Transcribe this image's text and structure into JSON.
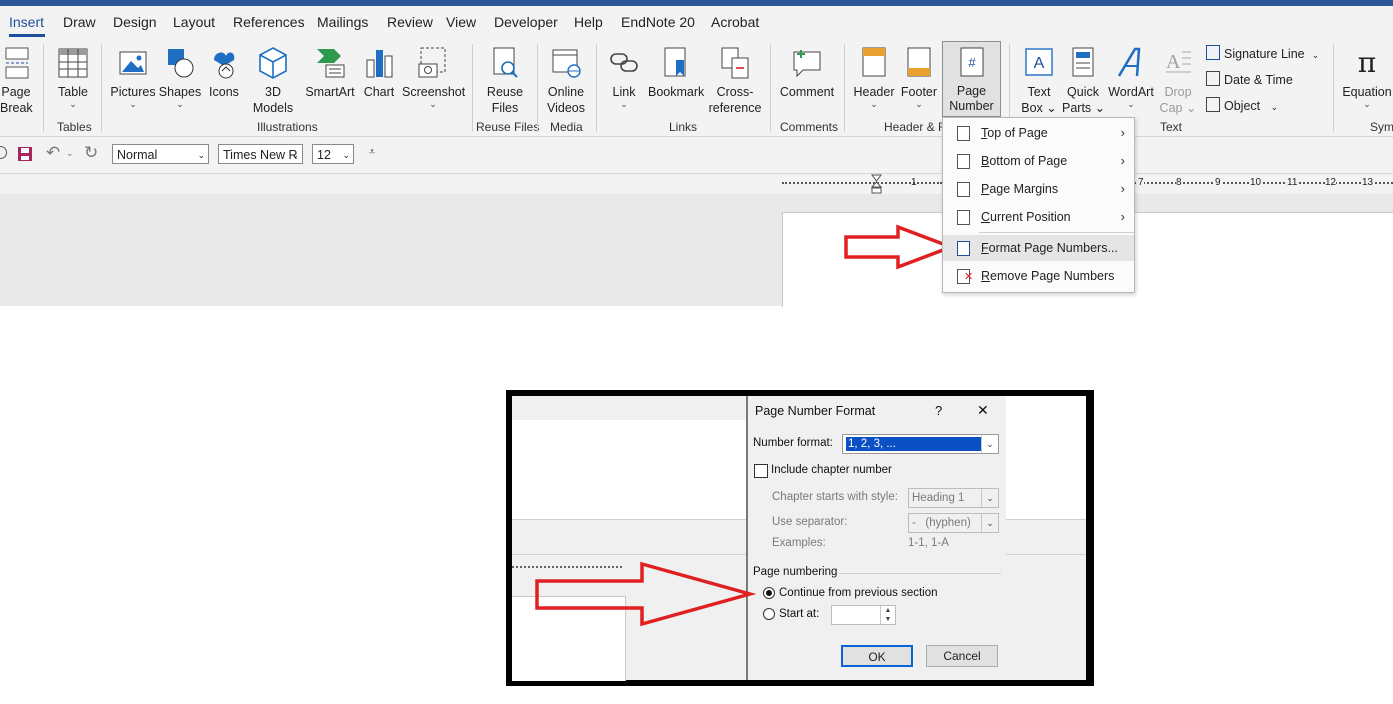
{
  "tabs": [
    "Insert",
    "Draw",
    "Design",
    "Layout",
    "References",
    "Mailings",
    "Review",
    "View",
    "Developer",
    "Help",
    "EndNote 20",
    "Acrobat"
  ],
  "ribbon": {
    "page_break": [
      "Page",
      "Break"
    ],
    "table": "Table",
    "pictures": "Pictures",
    "shapes": "Shapes",
    "icons": "Icons",
    "models_3d": [
      "3D",
      "Models"
    ],
    "smartart": "SmartArt",
    "chart": "Chart",
    "screenshot": "Screenshot",
    "reuse_files": [
      "Reuse",
      "Files"
    ],
    "online_videos": [
      "Online",
      "Videos"
    ],
    "link": "Link",
    "bookmark": "Bookmark",
    "cross_reference": [
      "Cross-",
      "reference"
    ],
    "comment": "Comment",
    "header": "Header",
    "footer": "Footer",
    "page_number": [
      "Page",
      "Number"
    ],
    "text_box": [
      "Text",
      "Box"
    ],
    "quick_parts": [
      "Quick",
      "Parts"
    ],
    "wordart": "WordArt",
    "drop_cap": [
      "Drop",
      "Cap"
    ],
    "signature_line": "Signature Line",
    "date_time": "Date & Time",
    "object": "Object",
    "equation": "Equation",
    "groups": {
      "tables": "Tables",
      "illustrations": "Illustrations",
      "reuse_files": "Reuse Files",
      "media": "Media",
      "links": "Links",
      "comments": "Comments",
      "header_footer": "Header & F",
      "text": "Text",
      "symbols": "Symb"
    }
  },
  "qat": {
    "style": "Normal",
    "font": "Times New R",
    "size": "12"
  },
  "ruler": [
    "1",
    "7",
    "8",
    "9",
    "10",
    "11",
    "12",
    "13"
  ],
  "menu": {
    "items": [
      {
        "label": "Top of Page",
        "accel": "T",
        "rest": "op of Page",
        "submenu": true
      },
      {
        "label": "Bottom of Page",
        "accel": "B",
        "rest": "ottom of Page",
        "submenu": true
      },
      {
        "label": "Page Margins",
        "accel": "P",
        "rest": "age Margins",
        "submenu": true
      },
      {
        "label": "Current Position",
        "accel": "C",
        "rest": "urrent Position",
        "submenu": true
      },
      {
        "label": "Format Page Numbers...",
        "accel": "F",
        "rest": "ormat Page Numbers...",
        "submenu": false
      },
      {
        "label": "Remove Page Numbers",
        "accel": "R",
        "rest": "emove Page Numbers",
        "submenu": false
      }
    ]
  },
  "dialog": {
    "title": "Page Number Format",
    "help": "?",
    "close": "✕",
    "number_format_label": "Number format:",
    "number_format_value": "1, 2, 3, ...",
    "include_chapter": "Include chapter number",
    "chapter_style_label": "Chapter starts with style:",
    "chapter_style_value": "Heading 1",
    "separator_label": "Use separator:",
    "separator_value": "-   (hyphen)",
    "examples_label": "Examples:",
    "examples_value": "1-1, 1-A",
    "page_numbering": "Page numbering",
    "continue_label": "Continue from previous section",
    "start_at_label": "Start at:",
    "start_at_value": "",
    "ok": "OK",
    "cancel": "Cancel"
  },
  "colors": {
    "accent": "#1e4e9e",
    "arrow": "#e02020",
    "selection": "#0a4fc4"
  }
}
